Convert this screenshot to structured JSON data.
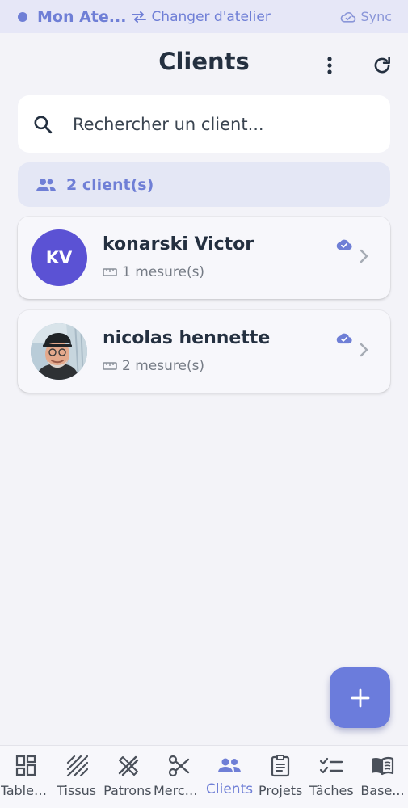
{
  "topbar": {
    "workshop_name": "Mon Ate...",
    "switch_label": "Changer d'atelier",
    "sync_label": "Sync"
  },
  "header": {
    "title": "Clients"
  },
  "search": {
    "placeholder": "Rechercher un client..."
  },
  "summary": {
    "count_label": "2 client(s)"
  },
  "clients": [
    {
      "initials": "KV",
      "name": "konarski Victor",
      "measures": "1 mesure(s)",
      "has_photo": false
    },
    {
      "initials": "",
      "name": "nicolas hennette",
      "measures": "2 mesure(s)",
      "has_photo": true
    }
  ],
  "nav": {
    "items": [
      {
        "label": "Tableau de bord",
        "icon": "dashboard-icon"
      },
      {
        "label": "Tissus",
        "icon": "fabric-icon"
      },
      {
        "label": "Patrons",
        "icon": "pattern-icon"
      },
      {
        "label": "Mercerie",
        "icon": "scissors-icon"
      },
      {
        "label": "Clients",
        "icon": "people-icon"
      },
      {
        "label": "Projets",
        "icon": "clipboard-icon"
      },
      {
        "label": "Tâches",
        "icon": "tasks-icon"
      },
      {
        "label": "Base...",
        "icon": "book-icon"
      }
    ],
    "active_index": 4
  },
  "colors": {
    "accent": "#6f7fd6",
    "avatar": "#5b52d4",
    "background": "#f3f3f8"
  }
}
